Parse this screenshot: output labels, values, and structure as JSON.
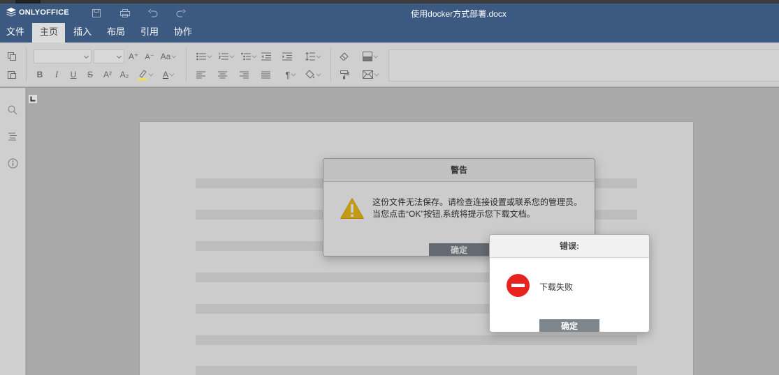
{
  "app": {
    "name": "ONLYOFFICE",
    "doc_title": "使用docker方式部署.docx"
  },
  "quick_access": {
    "save_icon": "save-icon",
    "print_icon": "print-icon",
    "undo_icon": "undo-icon",
    "redo_icon": "redo-icon"
  },
  "tabs": [
    {
      "label": "文件"
    },
    {
      "label": "主页"
    },
    {
      "label": "插入"
    },
    {
      "label": "布局"
    },
    {
      "label": "引用"
    },
    {
      "label": "协作"
    }
  ],
  "toolbar": {
    "font_name": "",
    "font_size": "",
    "increase_font": "A⁺",
    "decrease_font": "A⁻",
    "change_case": "Aa",
    "bold": "B",
    "italic": "I",
    "underline": "U",
    "strikethrough": "S",
    "superscript": "A²",
    "subscript": "A₂",
    "font_color": "A",
    "paragraph_mark": "¶"
  },
  "warning_dialog": {
    "title": "警告",
    "message_line1": "这份文件无法保存。请检查连接设置或联系您的管理员。",
    "message_line2": "当您点击“OK”按钮,系统将提示您下载文档。",
    "ok_label": "确定"
  },
  "error_dialog": {
    "title": "错误:",
    "message": "下载失败",
    "ok_label": "确定"
  },
  "colors": {
    "header_bg": "#3c5a81",
    "active_tab_bg": "#dcdcdc",
    "toolbar_bg": "#cfcfcf",
    "button_bg": "#7d858d",
    "error_red": "#e8231f",
    "warning_yellow": "#f4c21d"
  }
}
